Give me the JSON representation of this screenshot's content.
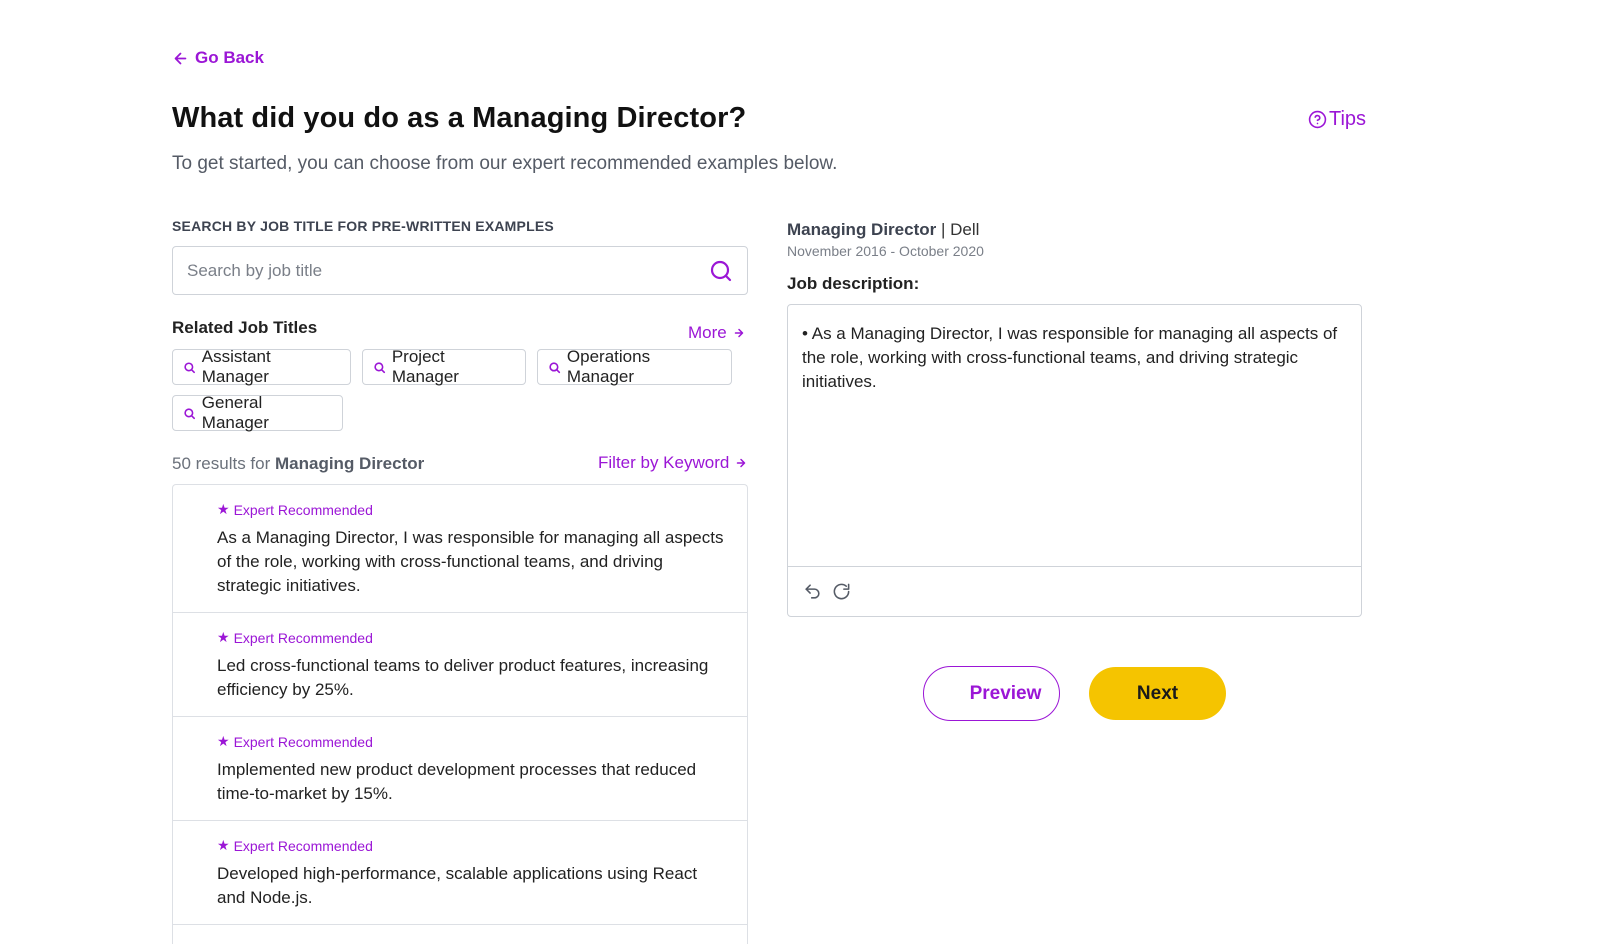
{
  "nav": {
    "go_back": "Go Back",
    "tips": "Tips"
  },
  "header": {
    "title": "What did you do as a Managing Director?",
    "subtitle": "To get started, you can choose from our expert recommended examples below."
  },
  "search": {
    "heading": "SEARCH BY JOB TITLE FOR PRE-WRITTEN EXAMPLES",
    "placeholder": "Search by job title",
    "value": ""
  },
  "related": {
    "title": "Related Job Titles",
    "more": "More",
    "chips": [
      "Assistant Manager",
      "Project Manager",
      "Operations Manager",
      "General Manager"
    ]
  },
  "results": {
    "count_prefix": "50 results for",
    "query": "Managing Director",
    "filter": "Filter by Keyword",
    "items": [
      {
        "badge": "Expert Recommended",
        "text": "As a Managing Director, I was responsible for managing all aspects of the role, working with cross-functional teams, and driving strategic initiatives."
      },
      {
        "badge": "Expert Recommended",
        "text": "Led cross-functional teams to deliver product features, increasing efficiency by 25%."
      },
      {
        "badge": "Expert Recommended",
        "text": "Implemented new product development processes that reduced time-to-market by 15%."
      },
      {
        "badge": "Expert Recommended",
        "text": "Developed high-performance, scalable applications using React and Node.js."
      }
    ]
  },
  "job": {
    "title": "Managing Director",
    "separator": "|",
    "company": "Dell",
    "dates": "November 2016 - October 2020",
    "description_label": "Job description:",
    "description": "• As a Managing Director, I was responsible for managing all aspects of the role, working with cross-functional teams, and driving strategic initiatives."
  },
  "actions": {
    "preview": "Preview",
    "next": "Next"
  },
  "colors": {
    "accent": "#9b16d6",
    "primary_button": "#f5c400",
    "border": "#cfd3d9"
  },
  "icons": [
    "arrow-left-icon",
    "question-circle-icon",
    "search-icon",
    "arrow-right-icon",
    "star-icon",
    "undo-icon",
    "redo-icon"
  ]
}
